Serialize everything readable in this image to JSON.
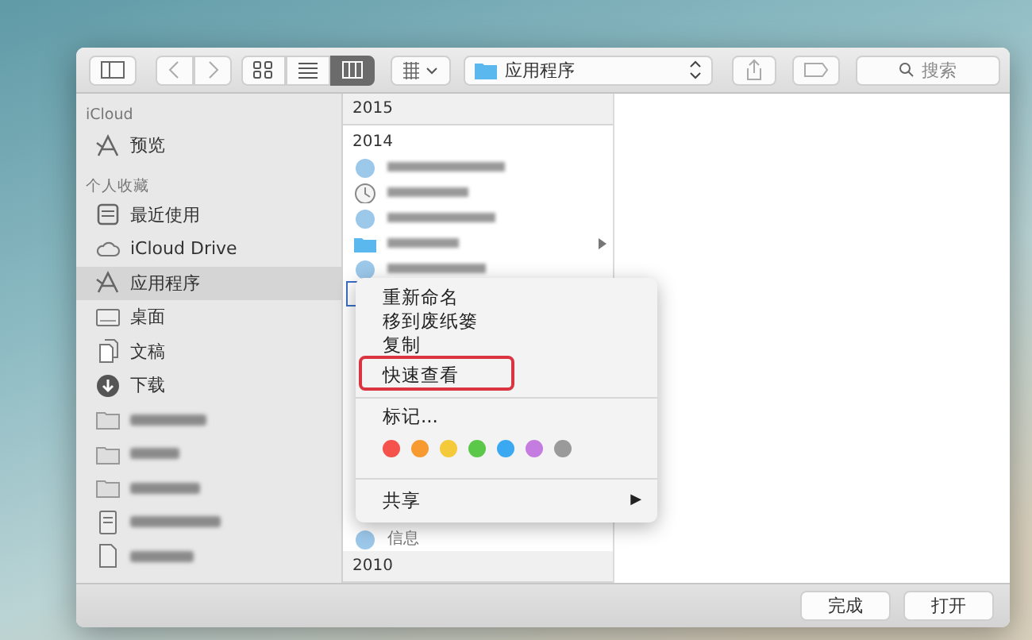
{
  "toolbar": {
    "view_modes": [
      {
        "kind": "icons",
        "selected": false
      },
      {
        "kind": "list",
        "selected": false
      },
      {
        "kind": "columns",
        "selected": true
      }
    ],
    "path": "应用程序",
    "search": {
      "placeholder": "搜索"
    }
  },
  "sidebar": {
    "sections": [
      {
        "title": "iCloud",
        "items": [
          {
            "kind": "app",
            "label": "预览",
            "selected": false
          }
        ]
      },
      {
        "title": "个人收藏",
        "items": [
          {
            "kind": "recent",
            "label": "最近使用",
            "selected": false
          },
          {
            "kind": "cloud",
            "label": "iCloud Drive",
            "selected": false
          },
          {
            "kind": "app",
            "label": "应用程序",
            "selected": true
          },
          {
            "kind": "desktop",
            "label": "桌面",
            "selected": false
          },
          {
            "kind": "docs",
            "label": "文稿",
            "selected": false
          },
          {
            "kind": "download",
            "label": "下载",
            "selected": false
          },
          {
            "kind": "folder",
            "selected": false
          },
          {
            "kind": "folder",
            "selected": false
          },
          {
            "kind": "folder",
            "selected": false
          },
          {
            "kind": "drive",
            "selected": false
          },
          {
            "kind": "file",
            "selected": false
          }
        ]
      }
    ]
  },
  "column": {
    "rows_above": [
      {
        "kind": "header",
        "text": "2015"
      },
      {
        "kind": "group",
        "text": "2014"
      },
      {
        "kind": "app",
        "has_children": false,
        "selected": false
      },
      {
        "kind": "clock",
        "has_children": false,
        "selected": false
      },
      {
        "kind": "app",
        "has_children": false,
        "selected": false
      },
      {
        "kind": "folder",
        "has_children": true,
        "selected": false
      },
      {
        "kind": "app",
        "has_children": false,
        "selected": false
      },
      {
        "kind": "blank",
        "has_children": false,
        "selected": true
      }
    ],
    "rows_below": [
      {
        "kind": "app",
        "text": "信息",
        "has_children": false,
        "selected": false
      },
      {
        "kind": "header",
        "text": "2010"
      }
    ]
  },
  "context_menu": {
    "items": [
      {
        "kind": "item",
        "label": "重新命名",
        "annotated": false
      },
      {
        "kind": "item",
        "label": "移到废纸篓",
        "annotated": false
      },
      {
        "kind": "item",
        "label": "复制",
        "annotated": false
      },
      {
        "kind": "item",
        "label": "快速查看",
        "annotated": true
      },
      {
        "kind": "separator"
      },
      {
        "kind": "item",
        "label": "标记...",
        "annotated": false
      },
      {
        "kind": "tags",
        "tags": [
          {
            "color": "#f5524c"
          },
          {
            "color": "#f79a30"
          },
          {
            "color": "#f4c93a"
          },
          {
            "color": "#5bc84a"
          },
          {
            "color": "#3ba8f2"
          },
          {
            "color": "#c47ce0"
          },
          {
            "color": "#9a9a9a"
          }
        ]
      },
      {
        "kind": "separator"
      },
      {
        "kind": "submenu",
        "label": "共享",
        "arrow": "▶"
      }
    ]
  },
  "footer": {
    "buttons": [
      "完成",
      "打开"
    ]
  }
}
